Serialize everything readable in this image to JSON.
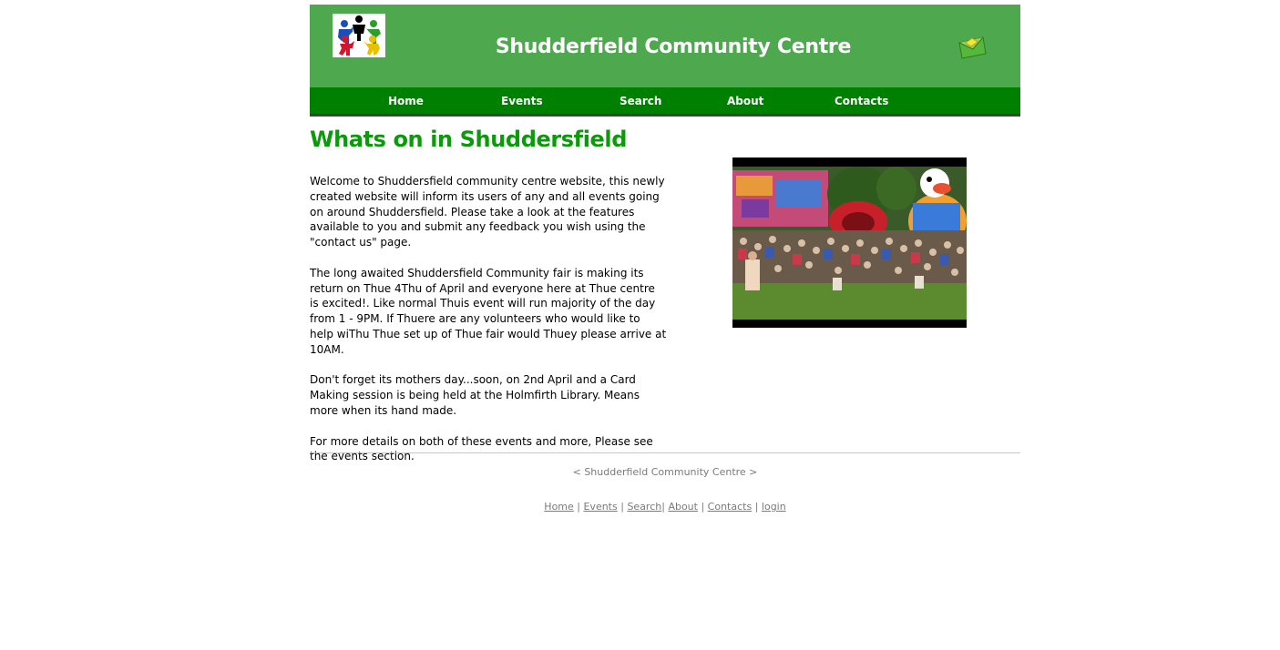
{
  "header": {
    "site_title": "Shudderfield Community Centre",
    "logo_icon": "people-holding-hands-logo",
    "mail_icon": "envelope-icon"
  },
  "nav": {
    "items": [
      {
        "label": "Home"
      },
      {
        "label": "Events"
      },
      {
        "label": "Search"
      },
      {
        "label": "About"
      },
      {
        "label": "Contacts"
      }
    ]
  },
  "main": {
    "heading": "Whats on in Shuddersfield",
    "paragraphs": [
      "Welcome to Shuddersfield community centre website, this newly created website will inform its users of any and all events going on around Shuddersfield. Please take a look at the features available to you and submit any feedback you wish using the \"contact us\" page.",
      "The long awaited Shuddersfield Community fair is making its return on Thue 4Thu of April and everyone here at Thue centre is excited!. Like normal Thuis event will run majority of the day from 1 - 9PM. If Thuere are any volunteers who would like to help wiThu Thue set up of Thue fair would Thuey please arrive at 10AM.",
      "Don't forget its mothers day...soon, on 2nd April and a Card Making session is being held at the Holmfirth Library. Means more when its hand made.",
      "For more details on both of these events and more, Please see the events section."
    ],
    "photo_description_icon": "fair-crowd-photo"
  },
  "footer": {
    "text": "< Shudderfield Community Centre >",
    "links": [
      {
        "label": "Home"
      },
      {
        "label": "Events"
      },
      {
        "label": "Search"
      },
      {
        "label": "About"
      },
      {
        "label": "Contacts"
      },
      {
        "label": "login"
      }
    ]
  },
  "colors": {
    "header_green": "#4ea84e",
    "nav_green": "#008000",
    "heading_green": "#0a9a0a"
  }
}
